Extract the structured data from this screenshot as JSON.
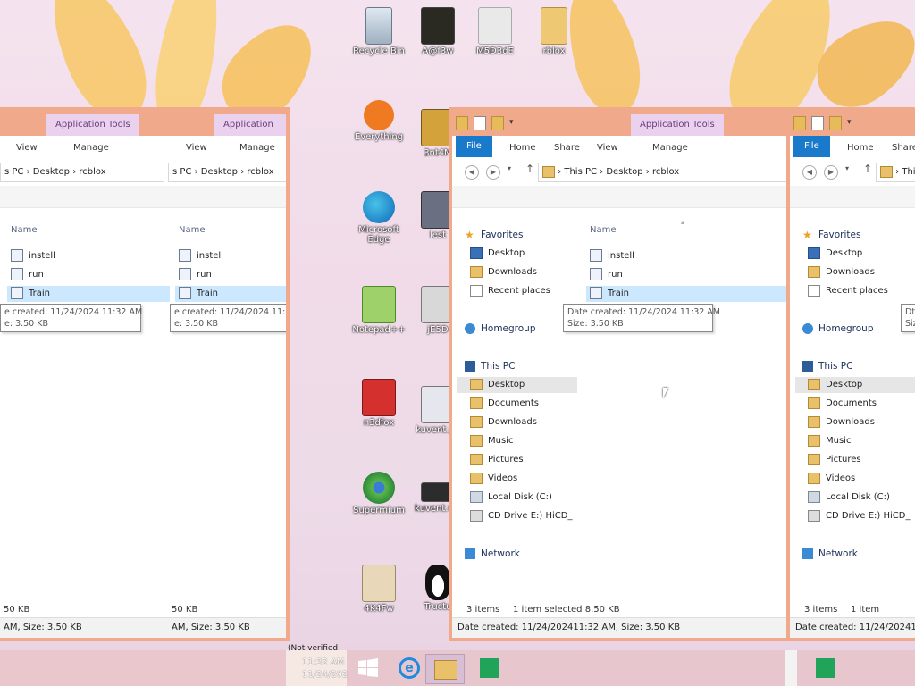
{
  "desktop": {
    "icons": [
      {
        "label": "Recycle Bin",
        "icon": "recycle-bin-icon"
      },
      {
        "label": "A@f3w",
        "icon": "image-file-icon"
      },
      {
        "label": "M5D3dE",
        "icon": "image-file-icon"
      },
      {
        "label": "rblox",
        "icon": "folder-icon"
      },
      {
        "label": "Everything",
        "icon": "everything-search-icon"
      },
      {
        "label": "3nt4M",
        "icon": "image-file-icon"
      },
      {
        "label": "Microsoft Edge",
        "icon": "edge-icon"
      },
      {
        "label": "lest",
        "icon": "image-file-icon"
      },
      {
        "label": "Notepad++",
        "icon": "notepadpp-icon"
      },
      {
        "label": "jE5D",
        "icon": "image-file-icon"
      },
      {
        "label": "n3dfox",
        "icon": "waterfox-icon"
      },
      {
        "label": "kuvent.pv",
        "icon": "image-file-icon"
      },
      {
        "label": "Supermium",
        "icon": "supermium-icon"
      },
      {
        "label": "kuvent.wa",
        "icon": "image-file-icon"
      },
      {
        "label": "4K4Fw",
        "icon": "image-file-icon"
      },
      {
        "label": "Tructu",
        "icon": "tux-icon"
      }
    ]
  },
  "explorer": {
    "app_tools_label": "Application Tools",
    "tabs": {
      "file": "File",
      "home": "Home",
      "share": "Share",
      "view": "View",
      "manage": "Manage"
    },
    "breadcrumb": {
      "root": "This PC",
      "folder1": "Desktop",
      "folder2": "rcblox",
      "truncated_root": "s PC",
      "truncated_root_r": "This"
    },
    "column_name": "Name",
    "files": [
      {
        "name": "instell",
        "icon": "batch-file-icon"
      },
      {
        "name": "run",
        "icon": "settings-file-icon"
      },
      {
        "name": "Train",
        "icon": "exe-file-icon",
        "selected": true
      }
    ],
    "tooltip": {
      "line1": "Date created: 11/24/2024 11:32 AM",
      "line2": "Size: 3.50 KB",
      "line1_short": "e created: 11/24/2024 11:32 AM",
      "line2_short": "e: 3.50 KB",
      "line1_r": "Dt",
      "line2_r": "Siz"
    },
    "nav": {
      "favorites": "Favorites",
      "fav_items": [
        "Desktop",
        "Downloads",
        "Recent places"
      ],
      "homegroup": "Homegroup",
      "thispc": "This PC",
      "pc_items": [
        "Desktop",
        "Documents",
        "Downloads",
        "Music",
        "Pictures",
        "Videos",
        "Local Disk (C:)",
        "CD Drive E:) HiCD_"
      ],
      "network": "Network"
    },
    "status": {
      "items": "3 items",
      "selected": "1 item selected  8.50 KB",
      "selected_r": "1 item selected  8",
      "left_size": "50 KB",
      "left_size2": "50 KB"
    },
    "details": {
      "full": "Date created: 11/24/202411:32 AM, Size: 3.50 KB",
      "left1": "AM, Size: 3.50 KB",
      "left2": "AM, Size: 3.50 KB",
      "right": "Date created: 11/24/202411:32 AM, Size: 3.50 KB"
    }
  },
  "taskbar": {
    "clock_time": "11:32 AM",
    "clock_date": "11/24/202",
    "not_verified": "(Not verified"
  }
}
